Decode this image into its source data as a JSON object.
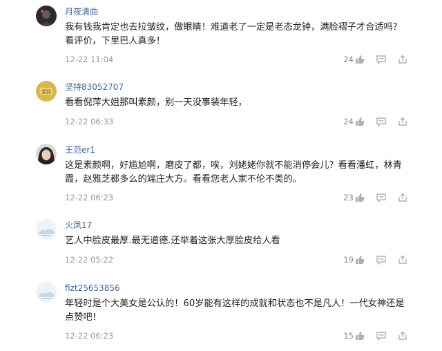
{
  "comments": [
    {
      "username": "月夜清曲",
      "text": "我有钱我肯定也去拉皱纹，做眼睛！难道老了一定是老态龙钟，满脸褶子才合适吗？\n看评价，下里巴人真多！",
      "time": "12-22 11:04",
      "likes": "24"
    },
    {
      "username": "坚持83052707",
      "text": "看看倪萍大姐那叫素颜，别一天没事装年轻，",
      "time": "12-22 06:33",
      "likes": "24",
      "avatar_label": "坚持"
    },
    {
      "username": "王范er1",
      "text": "这是素颜啊，好尴尬啊，磨皮了都，唉，刘姥姥你就不能消停会儿？看看潘虹，林青\n霞，赵雅芝都多么的端庄大方。看看您老人家不伦不类的。",
      "time": "12-22 06:23",
      "likes": "23"
    },
    {
      "username": "火凤17",
      "text": "艺人中脸皮最厚.最无道德.还举着这张大厚脸皮给人看",
      "time": "12-22 05:22",
      "likes": "19"
    },
    {
      "username": "flzt25653856",
      "text": "年轻时是个大美女是公认的！60岁能有这样的成就和状态也不是凡人！一代女神还是\n点赞吧！",
      "time": "12-22 06:23",
      "likes": "15"
    }
  ],
  "colors": {
    "username": "#406599",
    "text": "#222222",
    "time": "#999999",
    "icon": "#b0b0b0"
  },
  "icons": [
    "thumbs-up-icon",
    "comment-icon",
    "share-icon"
  ]
}
